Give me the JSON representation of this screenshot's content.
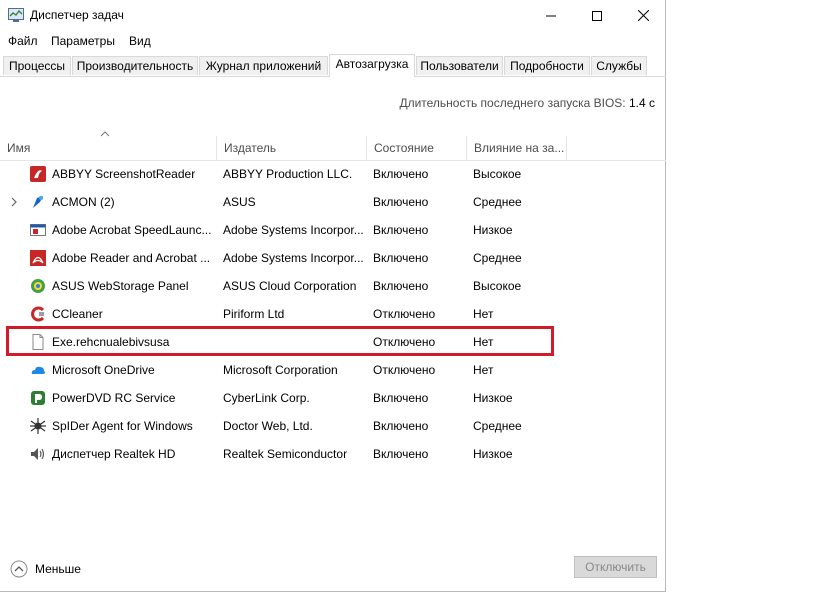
{
  "window": {
    "title": "Диспетчер задач"
  },
  "menu": {
    "file": "Файл",
    "params": "Параметры",
    "view": "Вид"
  },
  "tabs": [
    {
      "label": "Процессы"
    },
    {
      "label": "Производительность"
    },
    {
      "label": "Журнал приложений"
    },
    {
      "label": "Автозагрузка",
      "active": true
    },
    {
      "label": "Пользователи"
    },
    {
      "label": "Подробности"
    },
    {
      "label": "Службы"
    }
  ],
  "bios": {
    "label": "Длительность последнего запуска BIOS:",
    "value": "1.4 с"
  },
  "columns": {
    "name": "Имя",
    "publisher": "Издатель",
    "state": "Состояние",
    "impact": "Влияние на за..."
  },
  "rows": [
    {
      "name": "ABBYY ScreenshotReader",
      "publisher": "ABBYY Production LLC.",
      "state": "Включено",
      "impact": "Высокое",
      "icon": "abbyy-icon"
    },
    {
      "name": "ACMON (2)",
      "publisher": "ASUS",
      "state": "Включено",
      "impact": "Среднее",
      "icon": "acmon-icon"
    },
    {
      "name": "Adobe Acrobat SpeedLaunc...",
      "publisher": "Adobe Systems Incorpor...",
      "state": "Включено",
      "impact": "Низкое",
      "icon": "acrobat-speedlaunch-icon"
    },
    {
      "name": "Adobe Reader and Acrobat ...",
      "publisher": "Adobe Systems Incorpor...",
      "state": "Включено",
      "impact": "Среднее",
      "icon": "adobe-reader-icon"
    },
    {
      "name": "ASUS WebStorage Panel",
      "publisher": "ASUS Cloud Corporation",
      "state": "Включено",
      "impact": "Высокое",
      "icon": "asus-webstorage-icon"
    },
    {
      "name": "CCleaner",
      "publisher": "Piriform Ltd",
      "state": "Отключено",
      "impact": "Нет",
      "icon": "ccleaner-icon"
    },
    {
      "name": "Exe.rehcnualebivsusa",
      "publisher": "",
      "state": "Отключено",
      "impact": "Нет",
      "icon": "blank-file-icon"
    },
    {
      "name": "Microsoft OneDrive",
      "publisher": "Microsoft Corporation",
      "state": "Отключено",
      "impact": "Нет",
      "icon": "onedrive-icon"
    },
    {
      "name": "PowerDVD RC Service",
      "publisher": "CyberLink Corp.",
      "state": "Включено",
      "impact": "Низкое",
      "icon": "powerdvd-icon"
    },
    {
      "name": "SpIDer Agent for Windows",
      "publisher": "Doctor Web, Ltd.",
      "state": "Включено",
      "impact": "Среднее",
      "icon": "spider-icon"
    },
    {
      "name": "Диспетчер Realtek HD",
      "publisher": "Realtek Semiconductor",
      "state": "Включено",
      "impact": "Низкое",
      "icon": "speaker-icon"
    }
  ],
  "footer": {
    "less_label": "Меньше",
    "disable_label": "Отключить"
  },
  "colors": {
    "highlight": "#d11a2a",
    "tab_bg": "#f0f0f0",
    "header_text": "#4d4d4d"
  }
}
